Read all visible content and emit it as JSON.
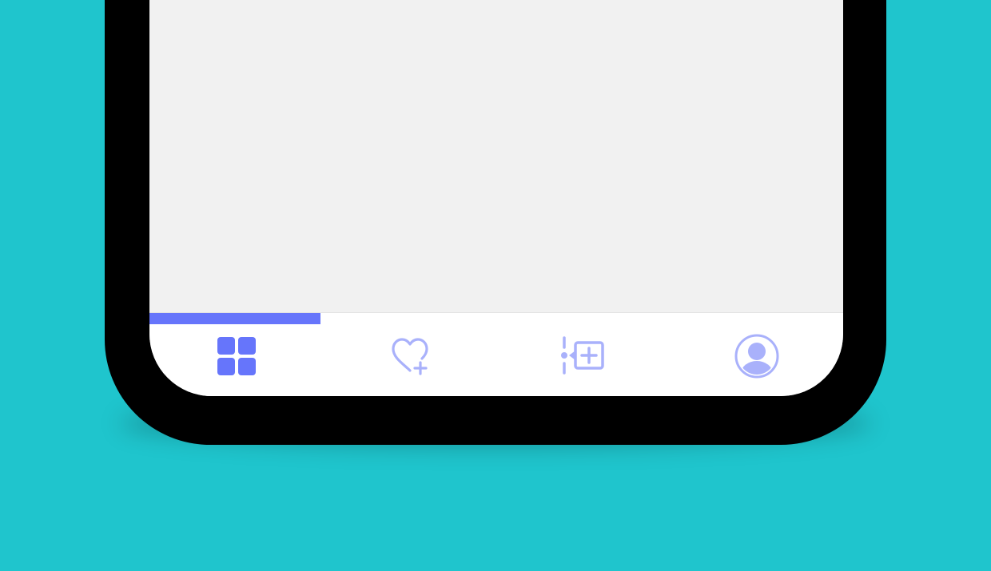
{
  "colors": {
    "background": "#1fc5cd",
    "frame": "#000000",
    "screen": "#f1f1f1",
    "tab_bar": "#ffffff",
    "accent_active": "#6675fb",
    "accent_inactive": "#a9b1fb"
  },
  "tab_bar": {
    "active_tab": 0,
    "tabs": [
      {
        "icon": "grid-icon",
        "active": true
      },
      {
        "icon": "heart-plus-icon",
        "active": false
      },
      {
        "icon": "add-item-icon",
        "active": false
      },
      {
        "icon": "profile-icon",
        "active": false
      }
    ]
  }
}
